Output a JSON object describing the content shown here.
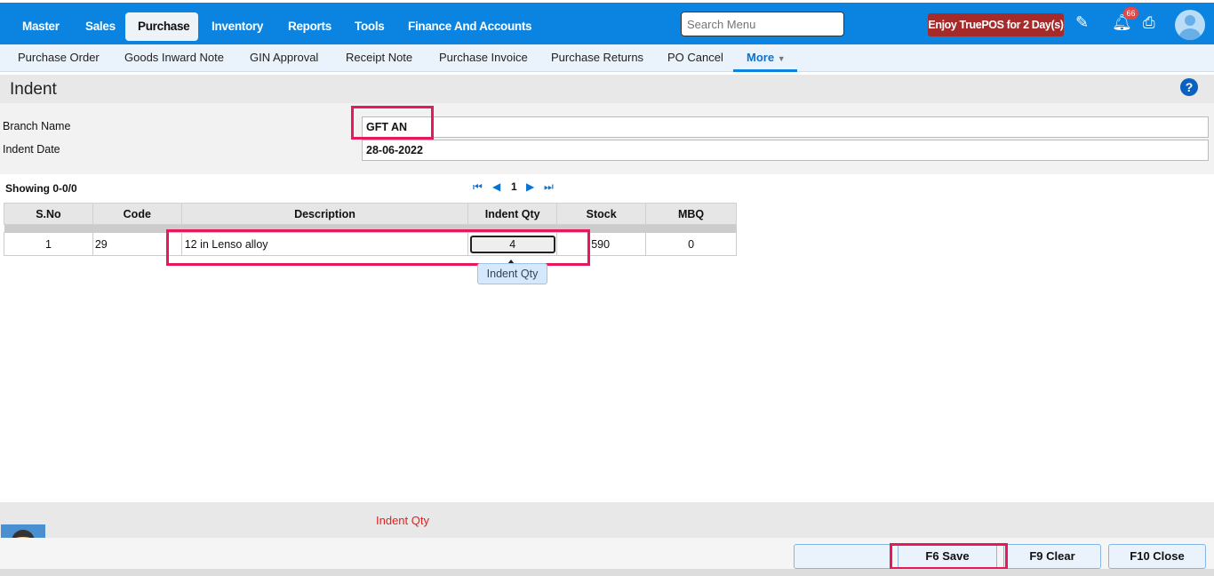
{
  "topnav": {
    "items": [
      "Master",
      "Sales",
      "Purchase",
      "Inventory",
      "Reports",
      "Tools",
      "Finance And Accounts"
    ],
    "active": "Purchase",
    "search_placeholder": "Search Menu",
    "promo": "Enjoy TruePOS for 2 Day(s)",
    "notification_count": "66"
  },
  "subnav": {
    "items": [
      "Purchase Order",
      "Goods Inward Note",
      "GIN Approval",
      "Receipt Note",
      "Purchase Invoice",
      "Purchase Returns",
      "PO Cancel"
    ],
    "more": "More"
  },
  "page": {
    "title": "Indent",
    "help": "?"
  },
  "form": {
    "branch_label": "Branch Name",
    "branch_value": "GFT AN",
    "date_label": "Indent Date",
    "date_value": "28-06-2022"
  },
  "grid": {
    "showing": "Showing 0-0/0",
    "page": "1",
    "columns": [
      "S.No",
      "Code",
      "Description",
      "Indent Qty",
      "Stock",
      "MBQ"
    ],
    "rows": [
      {
        "sno": "1",
        "code": "29",
        "description": "12 in Lenso alloy",
        "indent_qty": "4",
        "stock": "590",
        "mbq": "0"
      }
    ],
    "tooltip": "Indent Qty"
  },
  "status": {
    "message": "Indent Qty"
  },
  "buttons": {
    "save": "F6 Save",
    "clear": "F9 Clear",
    "close": "F10 Close"
  },
  "colors": {
    "primary": "#0a84e0",
    "promo": "#a52a2a",
    "highlight": "#e8195a",
    "error": "#e02020"
  }
}
